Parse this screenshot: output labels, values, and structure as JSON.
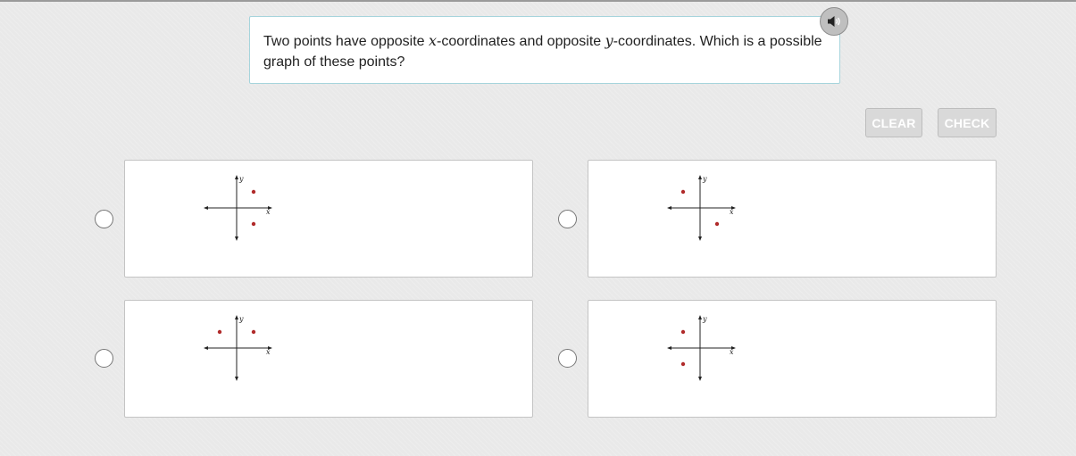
{
  "question": {
    "text_part1": "Two points have opposite ",
    "var_x": "x",
    "text_part2": "-coordinates and opposite ",
    "var_y": "y",
    "text_part3": "-coordinates. Which is a possible graph of these points?"
  },
  "audio_button": {
    "icon": "speaker-icon"
  },
  "buttons": {
    "clear_label": "CLEAR",
    "check_label": "CHECK"
  },
  "options": [
    {
      "id": "A",
      "x_axis_label": "x",
      "y_axis_label": "y",
      "points": [
        {
          "quadrant": "I"
        },
        {
          "quadrant": "IV"
        }
      ]
    },
    {
      "id": "B",
      "x_axis_label": "x",
      "y_axis_label": "y",
      "points": [
        {
          "quadrant": "II"
        },
        {
          "quadrant": "IV"
        }
      ]
    },
    {
      "id": "C",
      "x_axis_label": "x",
      "y_axis_label": "y",
      "points": [
        {
          "quadrant": "I"
        },
        {
          "quadrant": "II"
        }
      ]
    },
    {
      "id": "D",
      "x_axis_label": "x",
      "y_axis_label": "y",
      "points": [
        {
          "quadrant": "II"
        },
        {
          "quadrant": "III"
        }
      ]
    }
  ],
  "colors": {
    "point": "#b02a2a",
    "axis": "#222222",
    "question_border": "#a6d4dc",
    "button_disabled_bg": "#d9d9d9"
  }
}
